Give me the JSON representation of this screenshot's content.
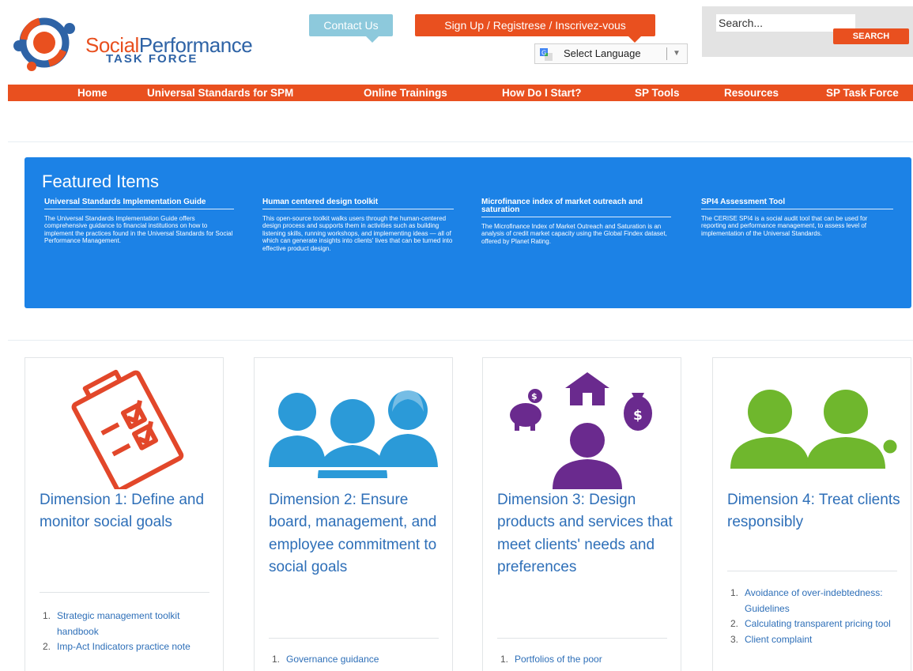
{
  "header": {
    "logo_text_1": "Social",
    "logo_text_2": "Performance",
    "logo_text_3": "TASK FORCE",
    "contact_label": "Contact Us",
    "signup_label": "Sign Up / Registrese / Inscrivez-vous",
    "language_label": "Select Language",
    "search_placeholder": "Search...",
    "search_button": "SEARCH"
  },
  "nav": {
    "items": [
      "Home",
      "Universal Standards for SPM",
      "Online Trainings",
      "How Do I Start?",
      "SP Tools",
      "Resources",
      "SP Task Force"
    ]
  },
  "featured": {
    "title": "Featured Items",
    "items": [
      {
        "heading": "Universal Standards Implementation Guide",
        "text": "The Universal Standards Implementation Guide offers comprehensive guidance to financial institutions on how to implement the practices found in the Universal Standards for Social Performance Management."
      },
      {
        "heading": "Human centered design toolkit",
        "text": "This open-source toolkit walks users through the human-centered design process and supports them in activities such as building listening skills, running workshops, and implementing ideas — all of which can generate insights into clients' lives that can be turned into effective product design."
      },
      {
        "heading": "Microfinance index of market outreach and saturation",
        "text": "The Microfinance Index of Market Outreach and Saturation is an analysis of credit market capacity using the Global Findex dataset, offered by Planet Rating."
      },
      {
        "heading": "SPI4 Assessment Tool",
        "text": "The CERISE SPI4 is a social audit tool that can be used for reporting and performance management, to assess level of implementation of the Universal Standards."
      }
    ]
  },
  "dimensions": [
    {
      "title": "Dimension 1: Define and monitor social goals",
      "icon": "clipboard-checklist-icon",
      "items": [
        "Strategic management toolkit handbook",
        "Imp-Act Indicators practice note"
      ]
    },
    {
      "title": "Dimension 2: Ensure board, management, and employee commitment to social goals",
      "icon": "people-group-icon",
      "items": [
        "Governance guidance"
      ]
    },
    {
      "title": "Dimension 3: Design products and services that meet clients' needs and preferences",
      "icon": "client-products-icon",
      "items": [
        "Portfolios of the poor"
      ]
    },
    {
      "title": "Dimension 4: Treat clients responsibly",
      "icon": "two-clients-icon",
      "items": [
        "Avoidance of over-indebtedness: Guidelines",
        "Calculating transparent pricing tool",
        "Client complaint"
      ]
    }
  ],
  "colors": {
    "brand_orange": "#e9501f",
    "brand_blue": "#2e63a6",
    "featured_blue": "#1c82e6",
    "contact_teal": "#8dc9dc",
    "dimension1_red": "#e2472a",
    "dimension2_blue": "#2b9ad8",
    "dimension3_purple": "#6a2a8e",
    "dimension4_green": "#6fb72d"
  }
}
